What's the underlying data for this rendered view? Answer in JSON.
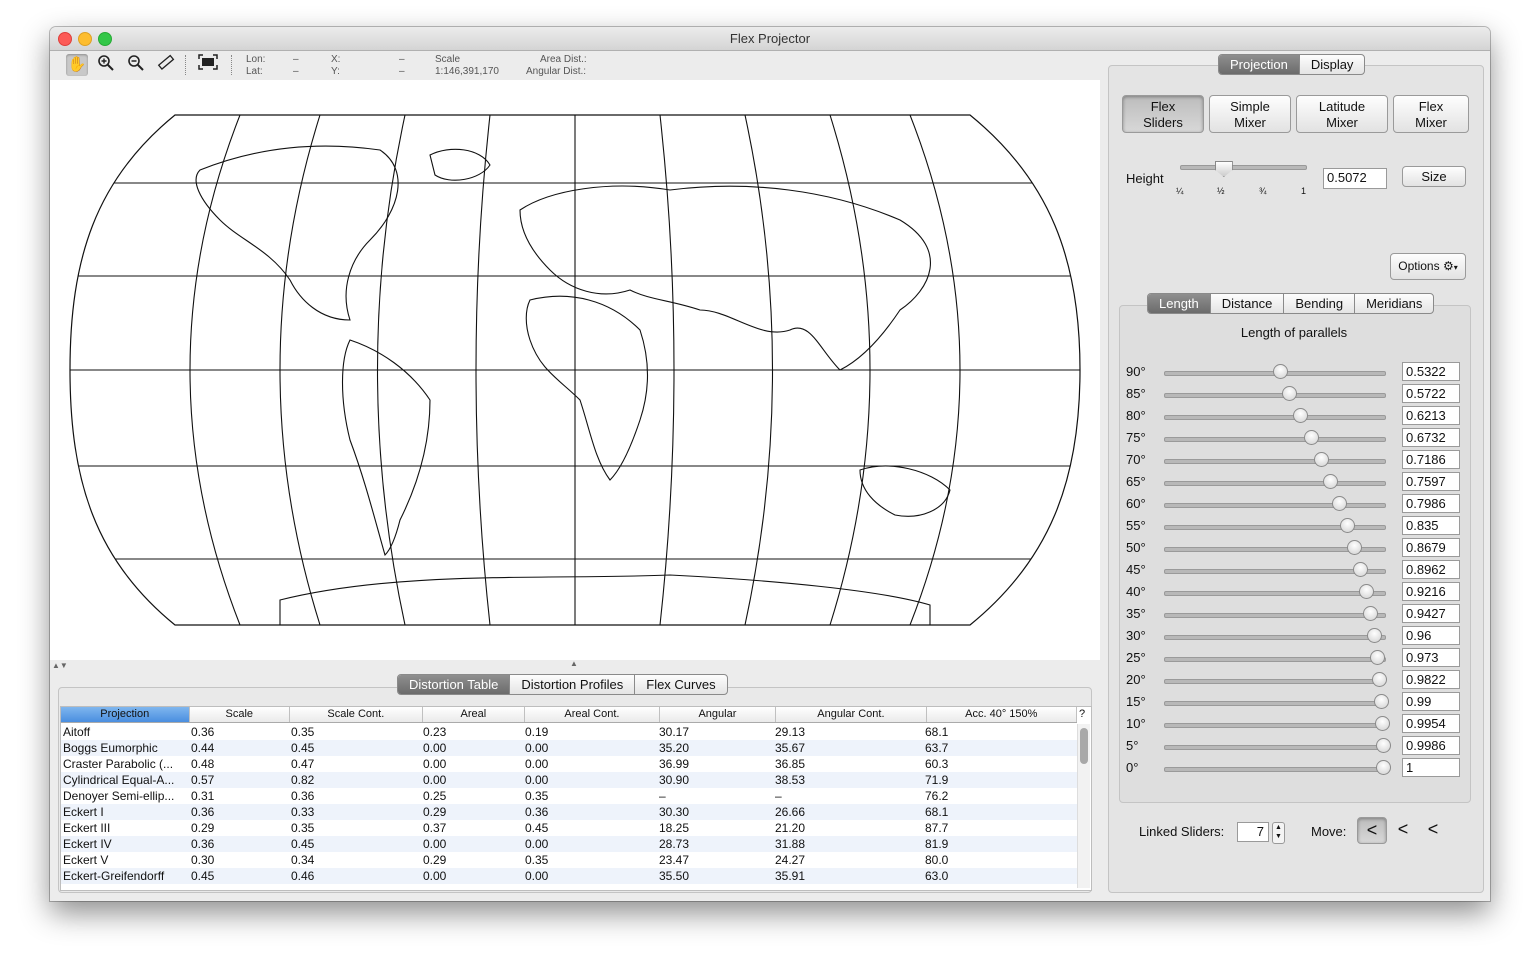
{
  "window": {
    "title": "Flex Projector"
  },
  "toolbar": {
    "icons": [
      "hand-icon",
      "zoom-in-icon",
      "zoom-out-icon",
      "ruler-icon",
      "fit-map-icon"
    ],
    "lon_label": "Lon:",
    "lat_label": "Lat:",
    "lon_value": "–",
    "lat_value": "–",
    "x_label": "X:",
    "y_label": "Y:",
    "x_value": "–",
    "y_value": "–",
    "scale_label": "Scale",
    "scale_value": "1:146,391,170",
    "area_dist_label": "Area Dist.:",
    "angular_dist_label": "Angular Dist.:"
  },
  "bottom_tabs": [
    "Distortion Table",
    "Distortion Profiles",
    "Flex Curves"
  ],
  "table": {
    "columns": [
      "Projection",
      "Scale",
      "Scale Cont.",
      "Areal",
      "Areal Cont.",
      "Angular",
      "Angular Cont.",
      "Acc. 40° 150%"
    ],
    "corner": "?",
    "rows": [
      [
        "Aitoff",
        "0.36",
        "0.35",
        "0.23",
        "0.19",
        "30.17",
        "29.13",
        "68.1"
      ],
      [
        "Boggs Eumorphic",
        "0.44",
        "0.45",
        "0.00",
        "0.00",
        "35.20",
        "35.67",
        "63.7"
      ],
      [
        "Craster Parabolic (...",
        "0.48",
        "0.47",
        "0.00",
        "0.00",
        "36.99",
        "36.85",
        "60.3"
      ],
      [
        "Cylindrical Equal-A...",
        "0.57",
        "0.82",
        "0.00",
        "0.00",
        "30.90",
        "38.53",
        "71.9"
      ],
      [
        "Denoyer Semi-ellip...",
        "0.31",
        "0.36",
        "0.25",
        "0.35",
        "–",
        "–",
        "76.2"
      ],
      [
        "Eckert I",
        "0.36",
        "0.33",
        "0.29",
        "0.36",
        "30.30",
        "26.66",
        "68.1"
      ],
      [
        "Eckert III",
        "0.29",
        "0.35",
        "0.37",
        "0.45",
        "18.25",
        "21.20",
        "87.7"
      ],
      [
        "Eckert IV",
        "0.36",
        "0.45",
        "0.00",
        "0.00",
        "28.73",
        "31.88",
        "81.9"
      ],
      [
        "Eckert V",
        "0.30",
        "0.34",
        "0.29",
        "0.35",
        "23.47",
        "24.27",
        "80.0"
      ],
      [
        "Eckert-Greifendorff",
        "0.45",
        "0.46",
        "0.00",
        "0.00",
        "35.50",
        "35.91",
        "63.0"
      ]
    ]
  },
  "right": {
    "top_tabs": [
      "Projection",
      "Display"
    ],
    "mode_buttons": [
      [
        "Flex",
        "Sliders"
      ],
      [
        "Simple",
        "Mixer"
      ],
      [
        "Latitude",
        "Mixer"
      ],
      [
        "Flex",
        "Mixer"
      ]
    ],
    "height_label": "Height",
    "height_ticks": [
      "¼",
      "½",
      "¾",
      "1"
    ],
    "height_value": "0.5072",
    "height_fraction": 0.5072,
    "size_button": "Size",
    "options_button": "Options",
    "options_icon": "gear-icon",
    "sub_tabs": [
      "Length",
      "Distance",
      "Bending",
      "Meridians"
    ],
    "section_title": "Length of parallels",
    "sliders": [
      {
        "label": "90°",
        "value": "0.5322"
      },
      {
        "label": "85°",
        "value": "0.5722"
      },
      {
        "label": "80°",
        "value": "0.6213"
      },
      {
        "label": "75°",
        "value": "0.6732"
      },
      {
        "label": "70°",
        "value": "0.7186"
      },
      {
        "label": "65°",
        "value": "0.7597"
      },
      {
        "label": "60°",
        "value": "0.7986"
      },
      {
        "label": "55°",
        "value": "0.835"
      },
      {
        "label": "50°",
        "value": "0.8679"
      },
      {
        "label": "45°",
        "value": "0.8962"
      },
      {
        "label": "40°",
        "value": "0.9216"
      },
      {
        "label": "35°",
        "value": "0.9427"
      },
      {
        "label": "30°",
        "value": "0.96"
      },
      {
        "label": "25°",
        "value": "0.973"
      },
      {
        "label": "20°",
        "value": "0.9822"
      },
      {
        "label": "15°",
        "value": "0.99"
      },
      {
        "label": "10°",
        "value": "0.9954"
      },
      {
        "label": "5°",
        "value": "0.9986"
      },
      {
        "label": "0°",
        "value": "1"
      }
    ],
    "linked_label": "Linked Sliders:",
    "linked_value": "7",
    "move_label": "Move:"
  }
}
